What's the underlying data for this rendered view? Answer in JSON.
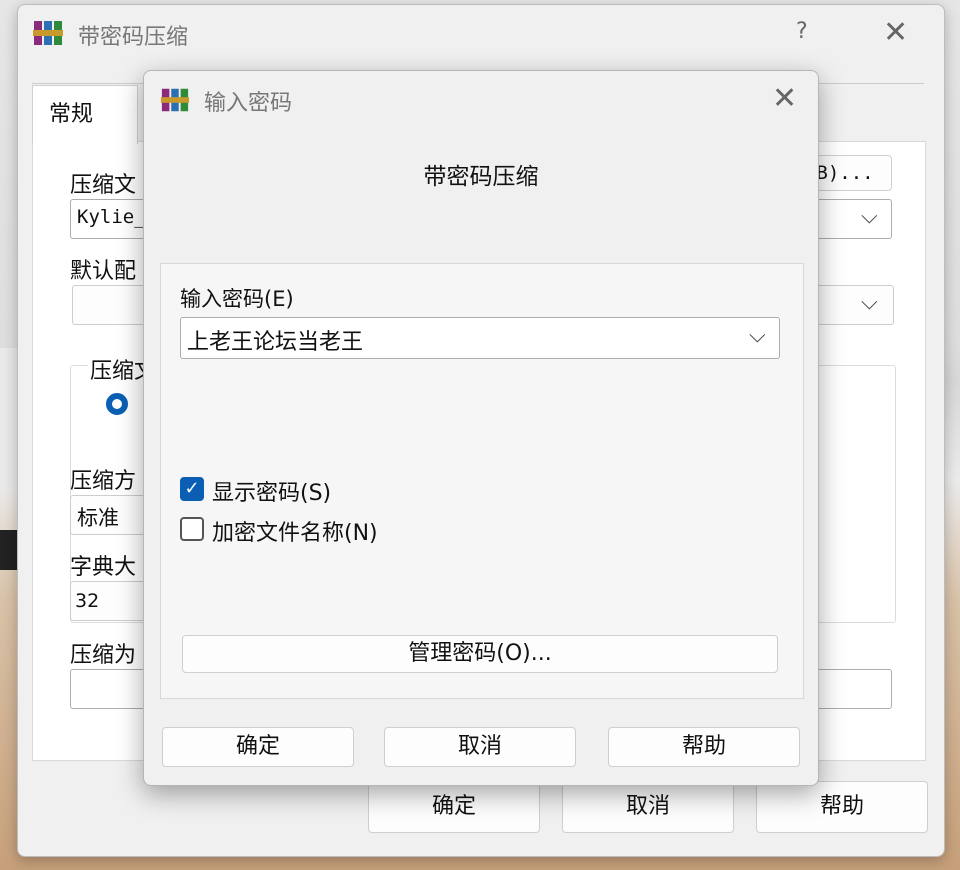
{
  "back_window": {
    "title": "带密码压缩",
    "help": "?",
    "close": "✕",
    "tab_general": "常规",
    "archive_name_label": "压缩文",
    "archive_name_value": "Kylie_",
    "browse_button": "B)...",
    "profile_label": "默认配",
    "format_group_label": "压缩文",
    "method_label": "压缩方",
    "method_value": "标准",
    "dict_label": "字典大",
    "dict_value": "32",
    "split_label": "压缩为",
    "ok": "确定",
    "cancel": "取消",
    "help_button": "帮助"
  },
  "dialog": {
    "title": "输入密码",
    "close": "✕",
    "heading": "带密码压缩",
    "password_label": "输入密码(E)",
    "password_value": "上老王论坛当老王",
    "show_password": {
      "label": "显示密码(S)",
      "checked": true
    },
    "encrypt_names": {
      "label": "加密文件名称(N)",
      "checked": false
    },
    "manage_button": "管理密码(O)...",
    "ok": "确定",
    "cancel": "取消",
    "help_button": "帮助"
  },
  "icons": {
    "app_icon": "winrar-books-icon",
    "dropdown": "chevron-down-icon",
    "checkmark": "✓"
  },
  "colors": {
    "accent": "#0a5fb4"
  }
}
